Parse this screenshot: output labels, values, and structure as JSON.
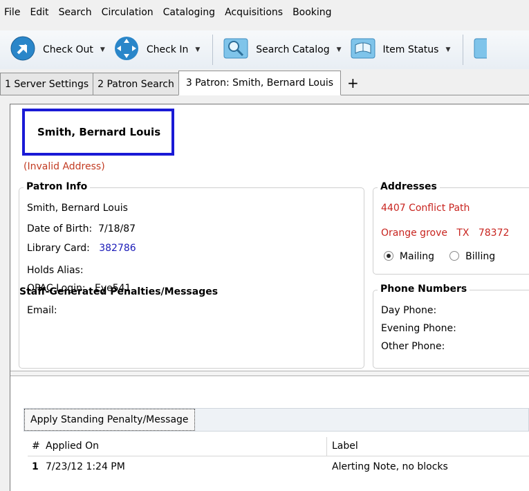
{
  "menu": {
    "file": "File",
    "edit": "Edit",
    "search": "Search",
    "circulation": "Circulation",
    "cataloging": "Cataloging",
    "acquisitions": "Acquisitions",
    "booking": "Booking"
  },
  "toolbar": {
    "check_out": "Check Out",
    "check_in": "Check In",
    "search_catalog": "Search Catalog",
    "item_status": "Item Status"
  },
  "tabs": [
    {
      "label": "1 Server Settings"
    },
    {
      "label": "2 Patron Search"
    },
    {
      "label": "3 Patron: Smith, Bernard Louis"
    }
  ],
  "tab_add": "+",
  "patron": {
    "display_name": "Smith, Bernard Louis",
    "address_warning": "(Invalid Address)",
    "info_title": "Patron Info",
    "full_name": "Smith, Bernard Louis",
    "dob_label": "Date of Birth:",
    "dob": "7/18/87",
    "card_label": "Library Card:",
    "card": "382786",
    "holds_alias_label": "Holds Alias:",
    "opac_label": "OPAC Login:",
    "opac": "Eye541",
    "email_label": "Email:"
  },
  "addresses": {
    "title": "Addresses",
    "street": "4407 Conflict Path",
    "city": "Orange grove",
    "state": "TX",
    "zip": "78372",
    "mailing_label": "Mailing",
    "billing_label": "Billing"
  },
  "phones": {
    "title": "Phone Numbers",
    "day_label": "Day Phone:",
    "evening_label": "Evening Phone:",
    "other_label": "Other Phone:"
  },
  "penalties": {
    "title": "Staff-Generated Penalties/Messages",
    "apply_button": "Apply Standing Penalty/Message",
    "columns": {
      "num": "#",
      "applied_on": "Applied On",
      "label": "Label"
    },
    "rows": [
      {
        "num": "1",
        "applied_on": "7/23/12 1:24 PM",
        "label": "Alerting Note, no blocks"
      }
    ]
  },
  "colors": {
    "accent": "#1a1ad6",
    "warning": "#c8241f",
    "link": "#1a1ab8"
  }
}
